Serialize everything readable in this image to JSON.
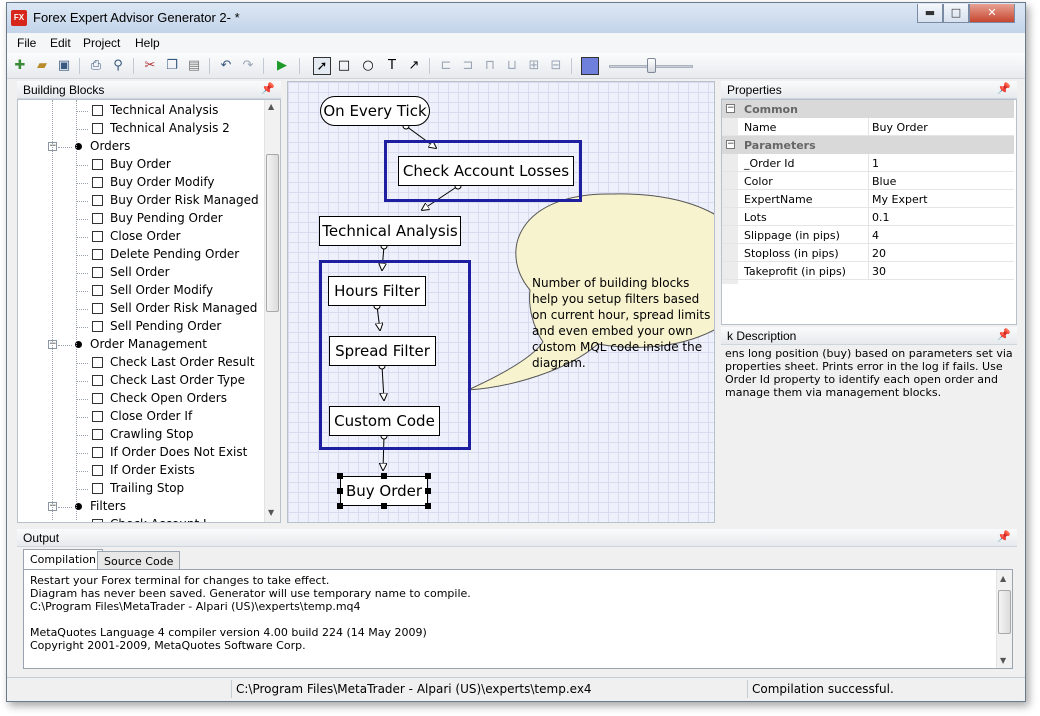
{
  "window": {
    "title": "Forex Expert Advisor Generator 2- *",
    "app_icon": "fx",
    "controls": {
      "minimize": "▬",
      "maximize": "□",
      "close": "✕"
    }
  },
  "menu": [
    "File",
    "Edit",
    "Project",
    "Help"
  ],
  "toolbar": {
    "icons": [
      "new-icon",
      "open-icon",
      "save-icon",
      "print-icon",
      "print-preview-icon",
      "cut-icon",
      "copy-icon",
      "paste-icon",
      "undo-icon",
      "redo-icon",
      "run-icon",
      "pointer-tool-icon",
      "rectangle-tool-icon",
      "ellipse-tool-icon",
      "text-tool-icon",
      "connector-tool-icon",
      "align-left-icon",
      "align-center-icon",
      "align-top-icon",
      "align-bottom-icon",
      "same-width-icon",
      "same-height-icon",
      "fill-color-icon"
    ],
    "slider_level": 0.45
  },
  "building_blocks": {
    "title": "Building Blocks",
    "items": [
      {
        "label": "Technical Analysis",
        "type": "leaf"
      },
      {
        "label": "Technical Analysis 2",
        "type": "leaf"
      },
      {
        "label": "Orders",
        "type": "group"
      },
      {
        "label": "Buy Order",
        "type": "leaf"
      },
      {
        "label": "Buy Order Modify",
        "type": "leaf"
      },
      {
        "label": "Buy Order Risk Managed",
        "type": "leaf"
      },
      {
        "label": "Buy Pending Order",
        "type": "leaf"
      },
      {
        "label": "Close Order",
        "type": "leaf"
      },
      {
        "label": "Delete Pending Order",
        "type": "leaf"
      },
      {
        "label": "Sell Order",
        "type": "leaf"
      },
      {
        "label": "Sell Order Modify",
        "type": "leaf"
      },
      {
        "label": "Sell Order Risk Managed",
        "type": "leaf"
      },
      {
        "label": "Sell Pending Order",
        "type": "leaf"
      },
      {
        "label": "Order Management",
        "type": "group"
      },
      {
        "label": "Check Last Order Result",
        "type": "leaf"
      },
      {
        "label": "Check Last Order Type",
        "type": "leaf"
      },
      {
        "label": "Check Open Orders",
        "type": "leaf"
      },
      {
        "label": "Close Order If",
        "type": "leaf"
      },
      {
        "label": "Crawling Stop",
        "type": "leaf"
      },
      {
        "label": "If Order Does Not Exist",
        "type": "leaf"
      },
      {
        "label": "If Order Exists",
        "type": "leaf"
      },
      {
        "label": "Trailing Stop",
        "type": "leaf"
      },
      {
        "label": "Filters",
        "type": "group"
      },
      {
        "label": "Check Account L",
        "type": "leaf"
      }
    ]
  },
  "diagram": {
    "start": "On Every Tick",
    "check_account": "Check Account Losses",
    "technical": "Technical Analysis",
    "hours": "Hours Filter",
    "spread": "Spread Filter",
    "custom": "Custom Code",
    "buy": "Buy Order",
    "callout": "Number of building blocks help you setup filters based on current hour, spread limits and even embed your own custom MQL code inside the diagram."
  },
  "properties": {
    "title": "Properties",
    "categories": {
      "common": "Common",
      "parameters": "Parameters"
    },
    "common_rows": [
      {
        "name": "Name",
        "value": "Buy Order"
      }
    ],
    "param_rows": [
      {
        "name": "_Order Id",
        "value": "1"
      },
      {
        "name": "Color",
        "value": "Blue"
      },
      {
        "name": "ExpertName",
        "value": "My Expert"
      },
      {
        "name": "Lots",
        "value": "0.1"
      },
      {
        "name": "Slippage (in pips)",
        "value": "4"
      },
      {
        "name": "Stoploss (in pips)",
        "value": "20"
      },
      {
        "name": "Takeprofit (in pips)",
        "value": "30"
      }
    ]
  },
  "description": {
    "title": "Description",
    "title_visible": "k Description",
    "text": "ens long position (buy) based on parameters set via properties sheet. Prints error in the log if fails. Use Order Id property to identify each open order and manage them via management blocks."
  },
  "output": {
    "title": "Output",
    "tabs": [
      "Compilation",
      "Source Code"
    ],
    "lines": [
      "Restart your Forex terminal for changes to take effect.",
      "Diagram has never been saved. Generator will use temporary name to compile.",
      "C:\\Program Files\\MetaTrader - Alpari (US)\\experts\\temp.mq4",
      "",
      "MetaQuotes Language 4 compiler version 4.00 build 224 (14 May 2009)",
      "Copyright 2001-2009, MetaQuotes Software Corp."
    ]
  },
  "status": {
    "path": "C:\\Program Files\\MetaTrader - Alpari (US)\\experts\\temp.ex4",
    "result": "Compilation successful."
  },
  "colors": {
    "group_border": "#1d1fa0",
    "callout_fill": "#f7f3cf",
    "canvas_bg": "#eef0fb"
  }
}
